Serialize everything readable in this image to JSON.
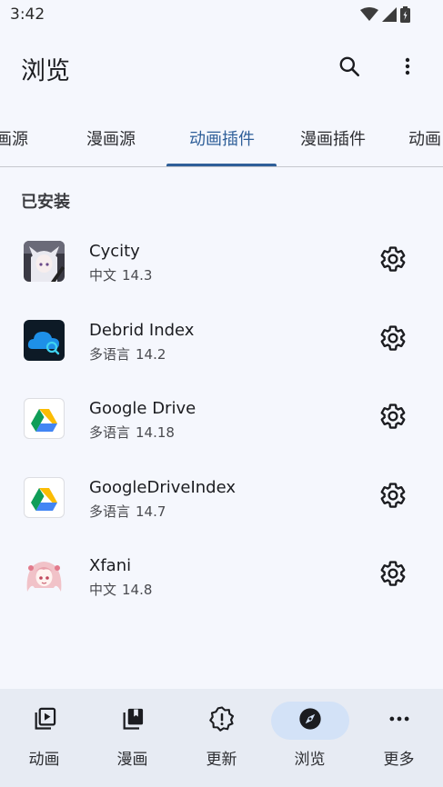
{
  "status_bar": {
    "time": "3:42",
    "icons": [
      "wifi-icon",
      "signal-icon",
      "battery-icon"
    ]
  },
  "app_bar": {
    "title": "浏览",
    "actions": [
      "search-icon",
      "more-vert-icon"
    ]
  },
  "tabs": {
    "items": [
      {
        "label": "画源"
      },
      {
        "label": "漫画源"
      },
      {
        "label": "动画插件"
      },
      {
        "label": "漫画插件"
      },
      {
        "label": "动画"
      }
    ],
    "active_index": 2
  },
  "section": {
    "title": "已安装"
  },
  "extensions": [
    {
      "name": "Cycity",
      "lang": "中文",
      "version": "14.3",
      "icon": "anime-girl-avatar"
    },
    {
      "name": "Debrid Index",
      "lang": "多语言",
      "version": "14.2",
      "icon": "cloud-search-icon"
    },
    {
      "name": "Google Drive",
      "lang": "多语言",
      "version": "14.18",
      "icon": "google-drive-icon"
    },
    {
      "name": "GoogleDriveIndex",
      "lang": "多语言",
      "version": "14.7",
      "icon": "google-drive-icon"
    },
    {
      "name": "Xfani",
      "lang": "中文",
      "version": "14.8",
      "icon": "anime-girl-avatar"
    }
  ],
  "bottom_nav": {
    "items": [
      {
        "label": "动画",
        "icon": "play-library-icon"
      },
      {
        "label": "漫画",
        "icon": "book-library-icon"
      },
      {
        "label": "更新",
        "icon": "alert-badge-icon"
      },
      {
        "label": "浏览",
        "icon": "compass-icon"
      },
      {
        "label": "更多",
        "icon": "more-horiz-icon"
      }
    ],
    "active_index": 3
  },
  "colors": {
    "background": "#f5f7fd",
    "accent": "#2f5f99",
    "nav_background": "#e7ebf3",
    "nav_active_pill": "#d3e2f7"
  }
}
